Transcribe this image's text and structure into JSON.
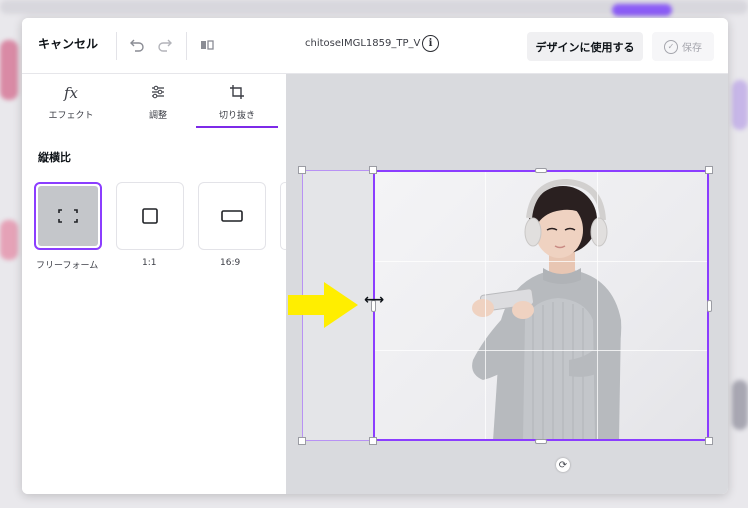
{
  "topbar": {
    "cancel_label": "キャンセル",
    "filename": "chitoseIMGL1859_TP_V",
    "use_design_label": "デザインに使用する",
    "save_label": "保存"
  },
  "tabs": [
    {
      "label": "エフェクト",
      "icon": "fx-icon"
    },
    {
      "label": "調整",
      "icon": "sliders-icon"
    },
    {
      "label": "切り抜き",
      "icon": "crop-icon",
      "active": true
    }
  ],
  "aspect": {
    "title": "縦横比",
    "options": [
      {
        "label": "フリーフォーム",
        "selected": true
      },
      {
        "label": "1:1"
      },
      {
        "label": "16:9"
      }
    ]
  },
  "colors": {
    "accent": "#8b3dff",
    "arrow": "#ffee00"
  }
}
